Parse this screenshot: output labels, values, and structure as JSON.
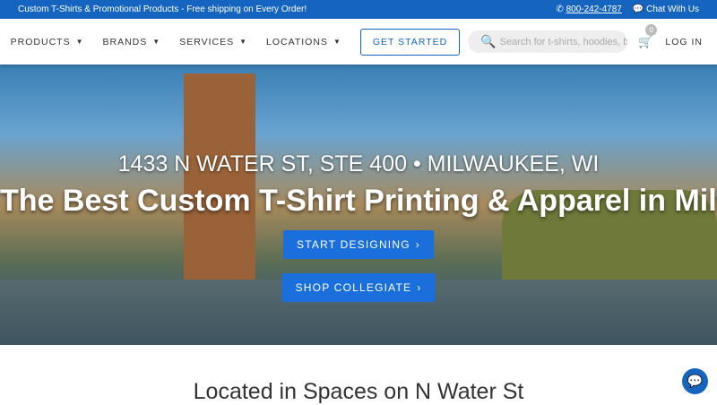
{
  "topbar": {
    "promo": "Custom T-Shirts & Promotional Products - Free shipping on Every Order!",
    "phone": "800-242-4787",
    "chat": "Chat With Us"
  },
  "nav": {
    "items": [
      {
        "label": "PRODUCTS"
      },
      {
        "label": "BRANDS"
      },
      {
        "label": "SERVICES"
      },
      {
        "label": "LOCATIONS"
      }
    ],
    "get_started": "GET STARTED",
    "search_placeholder": "Search for t-shirts, hoodies, ba",
    "cart_count": "0",
    "login": "LOG IN"
  },
  "hero": {
    "address": "1433 N WATER ST, STE 400 • MILWAUKEE, WI",
    "title": "The Best Custom T-Shirt Printing & Apparel in Milwaukee",
    "btn1": "START DESIGNING",
    "btn2": "SHOP COLLEGIATE"
  },
  "section": {
    "heading": "Located in Spaces on N Water St"
  },
  "colors": {
    "brand": "#1565c0",
    "button": "#1a6fdc"
  }
}
